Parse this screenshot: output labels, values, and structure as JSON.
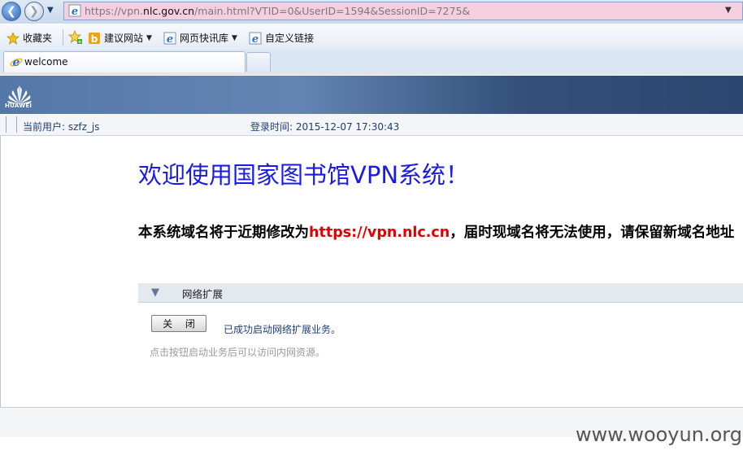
{
  "browser": {
    "url_prefix": "https://vpn.",
    "url_host": "nlc.gov.cn",
    "url_rest": "/main.html?VTID=0&UserID=1594&SessionID=7275&",
    "favorites_label": "收藏夹",
    "fav_items": [
      "建议网站",
      "网页快讯库",
      "自定义链接"
    ],
    "tab_title": "welcome"
  },
  "header": {
    "logo_text": "HUAWEI",
    "user_label": "当前用户: szfz_js",
    "login_time_label": "登录时间: 2015-12-07  17:30:43"
  },
  "main": {
    "welcome_title": "欢迎使用国家图书馆VPN系统！",
    "notice_before": "本系统域名将于近期修改为",
    "notice_link": "https://vpn.nlc.cn",
    "notice_after": "，届时现域名将无法使用，请保留新域名地址"
  },
  "extension": {
    "section_title": "网络扩展",
    "close_button": "关 闭",
    "status": "已成功启动网络扩展业务。",
    "hint": "点击按钮启动业务后可以访问内网资源。"
  },
  "watermark": "www.wooyun.org",
  "colors": {
    "banner": "#34507b",
    "title_blue": "#1a1ae6",
    "link_red": "#e00000",
    "url_bar": "#f5cfe0"
  }
}
